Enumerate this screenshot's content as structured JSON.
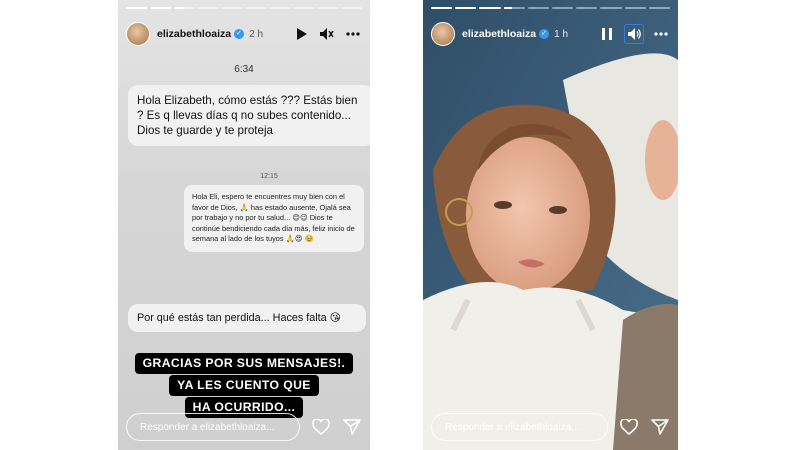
{
  "stories": [
    {
      "username": "elizabethloaiza",
      "time": "2 h",
      "progress": [
        1,
        1,
        0.5,
        0,
        0,
        0,
        0,
        0,
        0,
        0
      ],
      "clock": "6:34",
      "message1": "Hola Elizabeth, cómo estás ??? Estás bien ? Es q llevas días q no subes contenido... Dios te guarde y te proteja",
      "small_time": "12:15",
      "message2": "Hola Eli, espero te encuentres muy bien con el favor de Dios, 🙏 has estado ausente, Ojalá sea por trabajo y no por tu salud... 😊😉 Dios te continúe bendiciendo cada día más, feliz inicio de semana al lado de los tuyos 🙏😍 🥹",
      "message3": "Por qué estás tan perdida... Haces falta 😘",
      "caption": [
        "GRACIAS POR SUS MENSAJES!.",
        "YA LES CUENTO QUE",
        "HA OCURRIDO..."
      ],
      "reply_placeholder": "Responder a elizabethloaiza..."
    },
    {
      "username": "elizabethloaiza",
      "time": "1 h",
      "progress": [
        1,
        1,
        1,
        0.4,
        0,
        0,
        0,
        0,
        0,
        0
      ],
      "reply_placeholder": "Responder a elizabethloaiza..."
    }
  ],
  "icons": {
    "play": "play-icon",
    "mute": "mute-icon",
    "pause": "pause-icon",
    "volume": "volume-icon",
    "more": "more-icon",
    "heart": "heart-icon",
    "send": "send-icon"
  },
  "colors": {
    "verified": "#3897f0",
    "caption_bg": "#000000",
    "bubble": "#f1f1f1"
  }
}
